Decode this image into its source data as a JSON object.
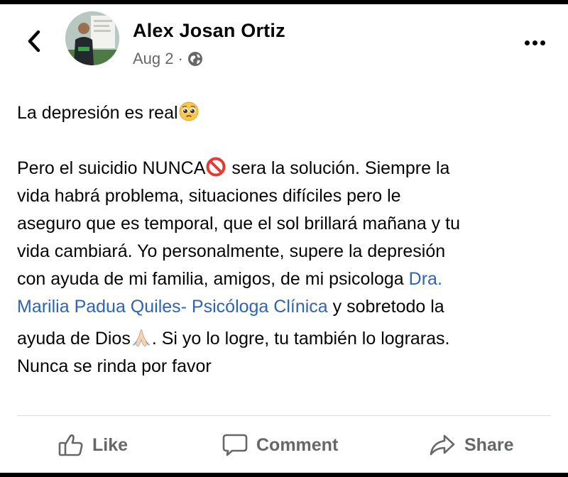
{
  "header": {
    "author_name": "Alex Josan Ortiz",
    "date": "Aug 2",
    "separator": "·",
    "audience_icon": "globe-icon",
    "back_icon": "chevron-left-icon",
    "more_icon": "more-horizontal-icon"
  },
  "post": {
    "line1_text": "La depresión es real",
    "line1_emoji": "pleading-face-emoji",
    "line2_a": "Pero el suicidio NUNCA",
    "line2_emoji": "prohibited-emoji",
    "line2_b": " sera  la solución. Siempre la",
    "line3": "vida habrá problema, situaciones difíciles pero le",
    "line4": "aseguro que es temporal, que el sol brillará mañana y tu",
    "line5": "vida cambiará. Yo personalmente, supere la depresión",
    "line6_text": "con ayuda de mi familia, amigos, de mi psicologa ",
    "line6_link": "Dra.",
    "line7_link": "Marilia Padua Quiles- Psicóloga Clínica",
    "line7_text": "  y sobretodo la",
    "line8_a": "ayuda de Dios",
    "line8_emoji": "folded-hands-emoji",
    "line8_b": ". Si yo lo logre, tu también lo lograras.",
    "line9": "Nunca se rinda por favor"
  },
  "actions": {
    "like_label": "Like",
    "like_icon": "thumbs-up-icon",
    "comment_label": "Comment",
    "comment_icon": "comment-icon",
    "share_label": "Share",
    "share_icon": "share-icon"
  },
  "colors": {
    "link": "#2d64b5",
    "secondary_text": "#65676b",
    "primary_text": "#050505"
  }
}
